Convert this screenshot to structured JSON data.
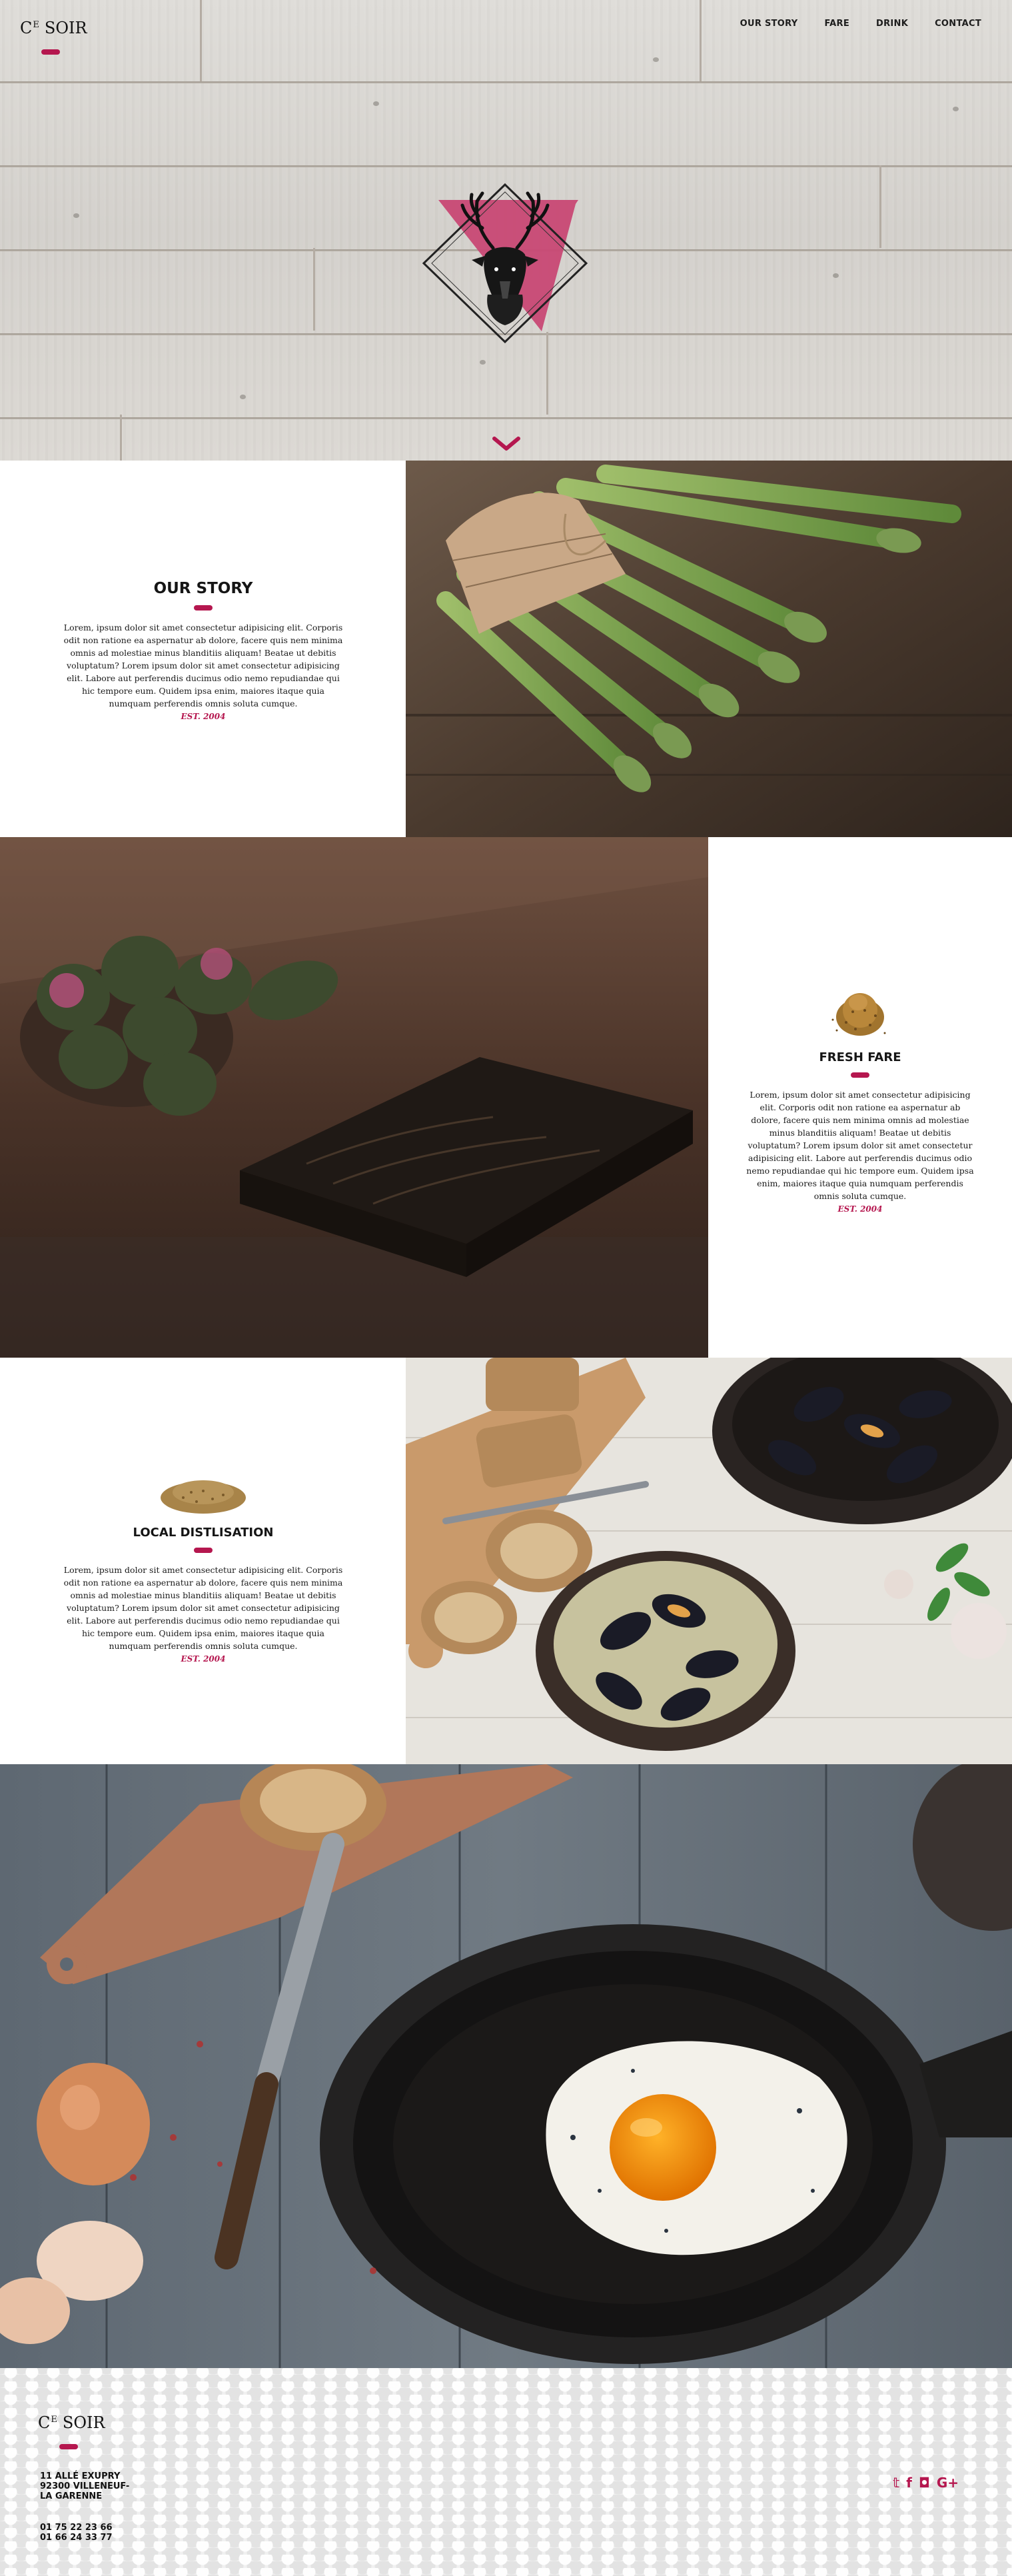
{
  "brand": {
    "ce": "C",
    "e": "E",
    "soir": "SOIR",
    "accent": "#b5174f"
  },
  "nav": {
    "story": "OUR STORY",
    "fare": "FARE",
    "drink": "DRINK",
    "contact": "CONTACT"
  },
  "hero": {
    "emblem_icon": "stag-head-icon",
    "scroll_icon": "chevron-down-icon"
  },
  "sections": [
    {
      "title": "OUR STORY",
      "body": "Lorem, ipsum dolor sit amet consectetur adipisicing elit. Corporis odit non ratione ea aspernatur ab dolore, facere quis nem minima omnis ad molestiae minus blanditiis aliquam! Beatae ut debitis voluptatum? Lorem ipsum dolor sit amet consectetur adipisicing elit. Labore aut perferendis ducimus odio nemo repudiandae qui hic tempore eum. Quidem ipsa enim, maiores itaque quia numquam perferendis omnis soluta cumque.",
      "est": "EST. 2004",
      "photo": "asparagus-bundle-photo"
    },
    {
      "title": "FRESH FARE",
      "body": "Lorem, ipsum dolor sit amet consectetur adipisicing elit. Corporis odit non ratione ea aspernatur ab dolore, facere quis nem minima omnis ad molestiae minus blanditiis aliquam! Beatae ut debitis voluptatum? Lorem ipsum dolor sit amet consectetur adipisicing elit. Labore aut perferendis ducimus odio nemo repudiandae qui hic tempore eum. Quidem ipsa enim, maiores itaque quia numquam perferendis omnis soluta cumque.",
      "est": "EST. 2004",
      "icon": "spice-pile-icon",
      "photo": "tea-brick-photo"
    },
    {
      "title": "LOCAL DISTLISATION",
      "body": "Lorem, ipsum dolor sit amet consectetur adipisicing elit. Corporis odit non ratione ea aspernatur ab dolore, facere quis nem minima omnis ad molestiae minus blanditiis aliquam! Beatae ut debitis voluptatum? Lorem ipsum dolor sit amet consectetur adipisicing elit. Labore aut perferendis ducimus odio nemo repudiandae qui hic tempore eum. Quidem ipsa enim, maiores itaque quia numquam perferendis omnis soluta cumque.",
      "est": "EST. 2004",
      "icon": "grain-pile-icon",
      "photo": "mussels-pots-photo"
    }
  ],
  "feature_photo": "fried-egg-skillet-photo",
  "footer": {
    "address_line1": "11 ALLÉ EXUPRY",
    "address_line2": "92300 VILLENEUF-",
    "address_line3": "LA GARENNE",
    "phone1": "01 75 22 23 66",
    "phone2": "01 66 24 33 77",
    "social": [
      {
        "icon": "twitter-icon",
        "glyph": "𝕥"
      },
      {
        "icon": "facebook-icon",
        "glyph": "f"
      },
      {
        "icon": "instagram-icon",
        "glyph": "◘"
      },
      {
        "icon": "google-plus-icon",
        "glyph": "G+"
      }
    ]
  }
}
